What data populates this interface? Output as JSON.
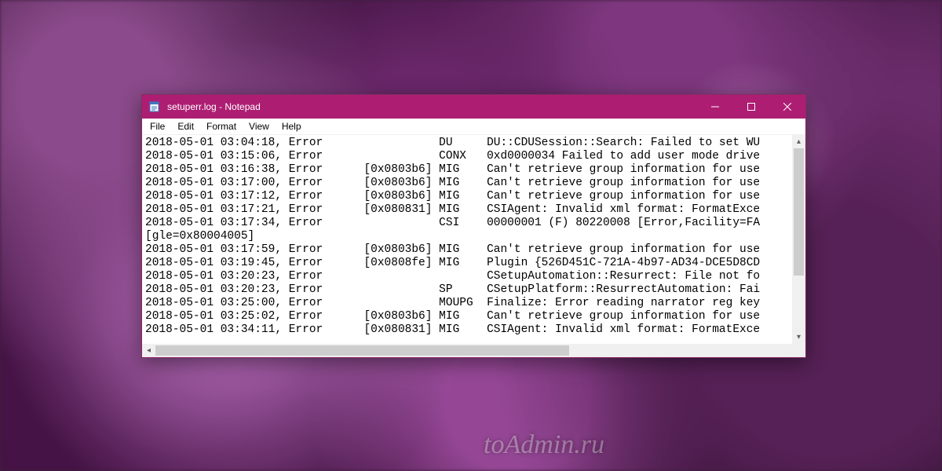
{
  "watermark": "toAdmin.ru",
  "window": {
    "title": "setuperr.log - Notepad",
    "menus": [
      "File",
      "Edit",
      "Format",
      "View",
      "Help"
    ]
  },
  "log_lines": [
    "2018-05-01 03:04:18, Error                 DU     DU::CDUSession::Search: Failed to set WU",
    "2018-05-01 03:15:06, Error                 CONX   0xd0000034 Failed to add user mode drive",
    "2018-05-01 03:16:38, Error      [0x0803b6] MIG    Can't retrieve group information for use",
    "2018-05-01 03:17:00, Error      [0x0803b6] MIG    Can't retrieve group information for use",
    "2018-05-01 03:17:12, Error      [0x0803b6] MIG    Can't retrieve group information for use",
    "2018-05-01 03:17:21, Error      [0x080831] MIG    CSIAgent: Invalid xml format: FormatExce",
    "2018-05-01 03:17:34, Error                 CSI    00000001 (F) 80220008 [Error,Facility=FA",
    "[gle=0x80004005]",
    "2018-05-01 03:17:59, Error      [0x0803b6] MIG    Can't retrieve group information for use",
    "2018-05-01 03:19:45, Error      [0x0808fe] MIG    Plugin {526D451C-721A-4b97-AD34-DCE5D8CD",
    "2018-05-01 03:20:23, Error                        CSetupAutomation::Resurrect: File not fo",
    "2018-05-01 03:20:23, Error                 SP     CSetupPlatform::ResurrectAutomation: Fai",
    "2018-05-01 03:25:00, Error                 MOUPG  Finalize: Error reading narrator reg key",
    "2018-05-01 03:25:02, Error      [0x0803b6] MIG    Can't retrieve group information for use",
    "2018-05-01 03:34:11, Error      [0x080831] MIG    CSIAgent: Invalid xml format: FormatExce"
  ]
}
